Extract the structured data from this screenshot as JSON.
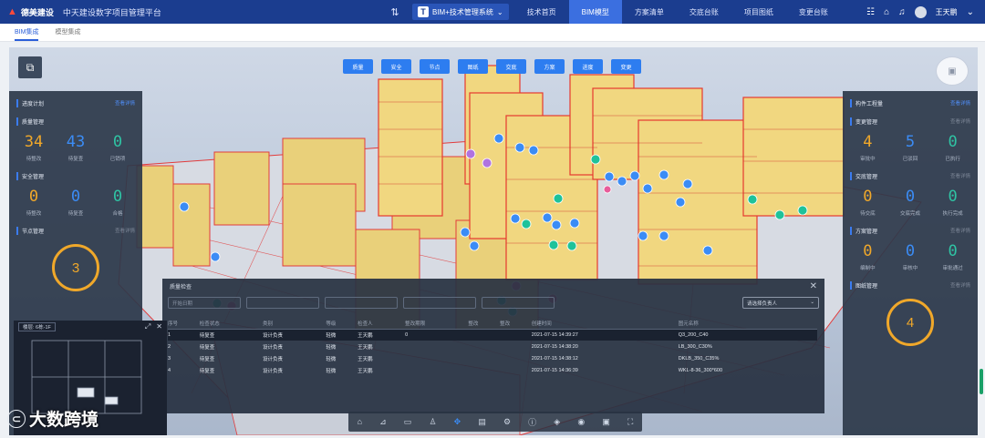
{
  "header": {
    "company": "德美建设",
    "platform": "中天建设数字项目管理平台",
    "system_select": "BIM+技术管理系统",
    "nav": [
      "技术首页",
      "BIM模型",
      "方案清单",
      "交底台账",
      "项目图纸",
      "变更台账"
    ],
    "nav_active_index": 1,
    "user": "王天鹏"
  },
  "subtabs": [
    "BIM集成",
    "模型集成"
  ],
  "subtabs_active_index": 0,
  "viewer": {
    "filters": [
      "质量",
      "安全",
      "节点",
      "图纸",
      "交底",
      "方案",
      "进度",
      "变更"
    ]
  },
  "left_panel": {
    "sections": [
      {
        "title": "进度计划",
        "link": "查看详情",
        "link_active": true
      },
      {
        "title": "质量管理",
        "link": "",
        "stats": [
          {
            "value": "34",
            "label": "待整改",
            "color": "#f0a82a"
          },
          {
            "value": "43",
            "label": "待复查",
            "color": "#3b8cf5"
          },
          {
            "value": "0",
            "label": "已销项",
            "color": "#2fc4a4"
          }
        ]
      },
      {
        "title": "安全管理",
        "link": "",
        "stats": [
          {
            "value": "0",
            "label": "待整改",
            "color": "#f0a82a"
          },
          {
            "value": "0",
            "label": "待复查",
            "color": "#3b8cf5"
          },
          {
            "value": "0",
            "label": "合格",
            "color": "#2fc4a4"
          }
        ]
      },
      {
        "title": "节点管理",
        "link": "查看详情",
        "link_active": false
      }
    ],
    "ring_value": "3"
  },
  "right_panel": {
    "sections": [
      {
        "title": "构件工程量",
        "link": "查看详情",
        "link_active": true
      },
      {
        "title": "变更管理",
        "link": "查看详情",
        "link_active": false,
        "stats": [
          {
            "value": "4",
            "label": "审批中",
            "color": "#f0a82a"
          },
          {
            "value": "5",
            "label": "已驳回",
            "color": "#3b8cf5"
          },
          {
            "value": "0",
            "label": "已执行",
            "color": "#2fc4a4"
          }
        ]
      },
      {
        "title": "交底管理",
        "link": "查看详情",
        "link_active": false,
        "stats": [
          {
            "value": "0",
            "label": "待交底",
            "color": "#f0a82a"
          },
          {
            "value": "0",
            "label": "交底完成",
            "color": "#3b8cf5"
          },
          {
            "value": "0",
            "label": "执行完成",
            "color": "#2fc4a4"
          }
        ]
      },
      {
        "title": "方案管理",
        "link": "查看详情",
        "link_active": false,
        "stats": [
          {
            "value": "0",
            "label": "编制中",
            "color": "#f0a82a"
          },
          {
            "value": "0",
            "label": "审核中",
            "color": "#3b8cf5"
          },
          {
            "value": "0",
            "label": "审批通过",
            "color": "#2fc4a4"
          }
        ]
      },
      {
        "title": "图纸管理",
        "link": "查看详情",
        "link_active": false
      }
    ],
    "ring_value": "4"
  },
  "table": {
    "title": "质量检查",
    "close_icon": "close-icon",
    "filter_placeholders": [
      "开始日期",
      "",
      "",
      "",
      ""
    ],
    "select_label": "请选择负责人",
    "columns": [
      "序号",
      "检查状态",
      "类别",
      "等级",
      "检查人",
      "整改期限",
      "整改",
      "整改",
      "创建时间",
      "图元名称"
    ],
    "rows": [
      [
        "1",
        "待复查",
        "设计负责",
        "轻微",
        "王天鹏",
        "0",
        "",
        "",
        "2021-07-15 14:39:27",
        "Q3_200_C40"
      ],
      [
        "2",
        "待复查",
        "设计负责",
        "轻微",
        "王天鹏",
        "",
        "",
        "",
        "2021-07-15 14:38:20",
        "LB_300_C30%"
      ],
      [
        "3",
        "待复查",
        "设计负责",
        "轻微",
        "王天鹏",
        "",
        "",
        "",
        "2021-07-15 14:38:12",
        "DKLB_350_C35%"
      ],
      [
        "4",
        "待复查",
        "设计负责",
        "轻微",
        "王天鹏",
        "",
        "",
        "",
        "2021-07-15 14:36:39",
        "WKL-8-36_300*600"
      ]
    ],
    "selected_row": 0
  },
  "minimap": {
    "floor_select": "楼层: 6栋-1F"
  },
  "watermark": "大数跨境"
}
